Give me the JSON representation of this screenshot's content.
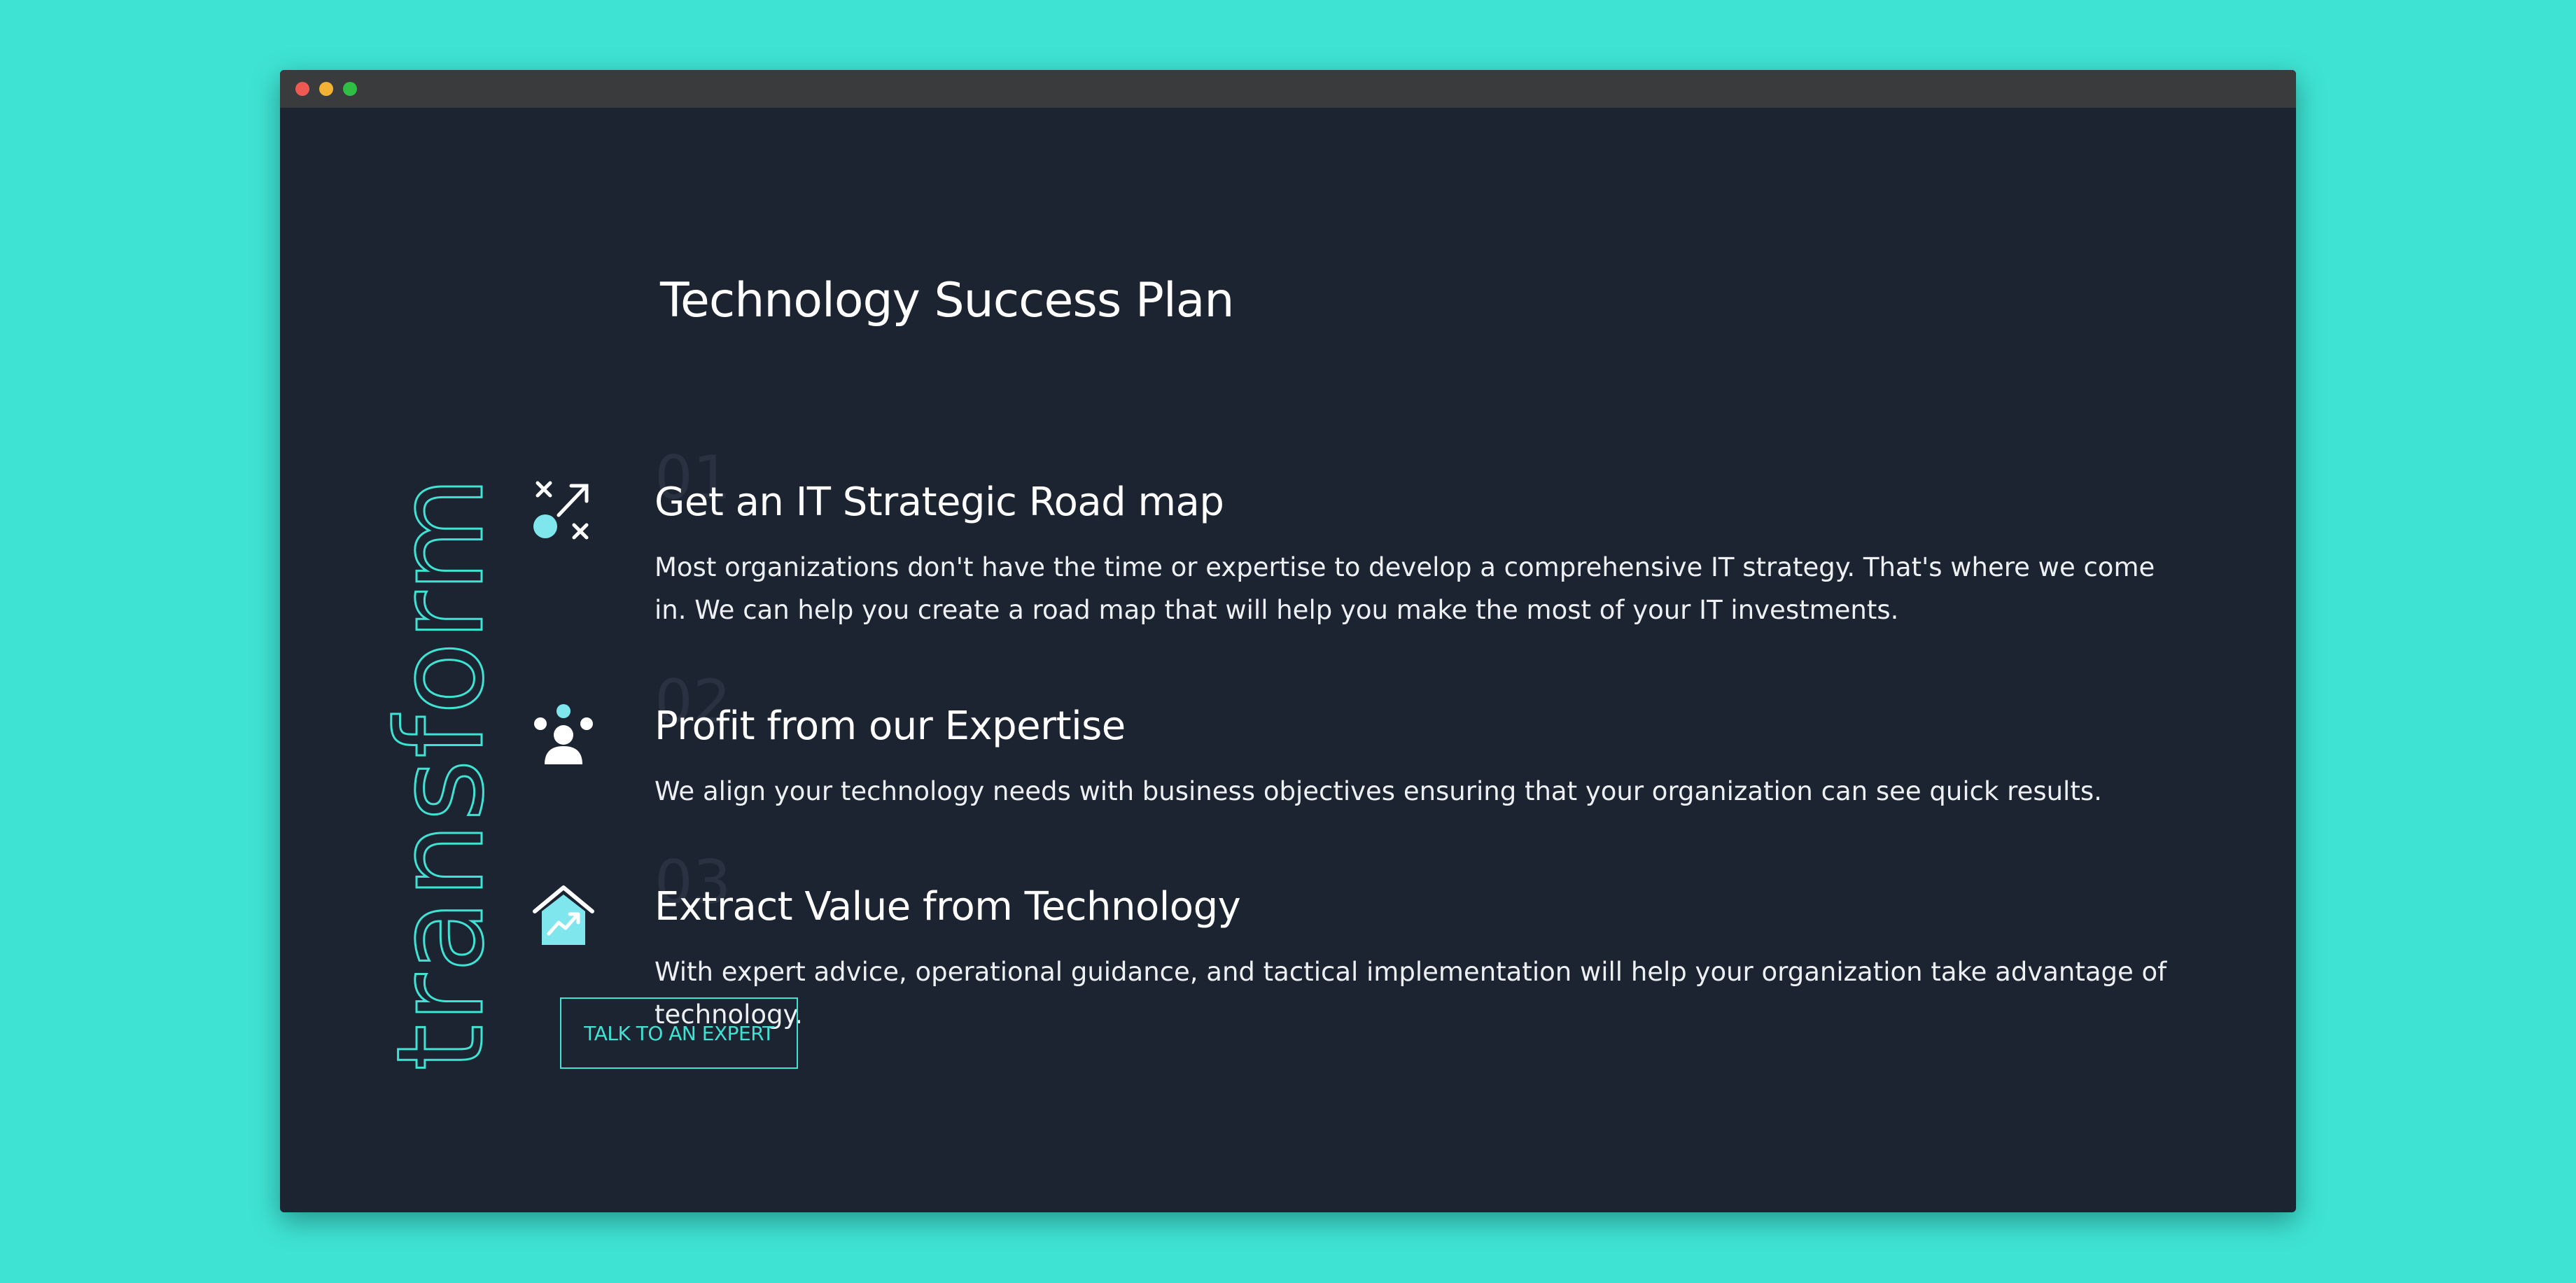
{
  "side_word": "transform",
  "main": {
    "title": "Technology Success Plan",
    "steps": [
      {
        "number": "01",
        "icon": "strategy-play-icon",
        "title": "Get an IT Strategic Road map",
        "description": "Most organizations don't have the time or expertise to develop a comprehensive IT strategy. That's where we come in. We can help you create a road map that will help you make the most of your IT investments."
      },
      {
        "number": "02",
        "icon": "expert-team-icon",
        "title": "Profit from our Expertise",
        "description": "We align your technology needs with business objectives ensuring that your organization can see quick results."
      },
      {
        "number": "03",
        "icon": "house-growth-icon",
        "title": "Extract Value from Technology",
        "description": "With expert advice, operational guidance, and tactical implementation will help your organization take advantage of technology."
      }
    ],
    "cta_label": "TALK TO AN EXPERT"
  },
  "colors": {
    "background": "#3ee3d4",
    "panel": "#1c2331",
    "accent": "#3ee3d4",
    "titlebar": "#393b3d"
  }
}
